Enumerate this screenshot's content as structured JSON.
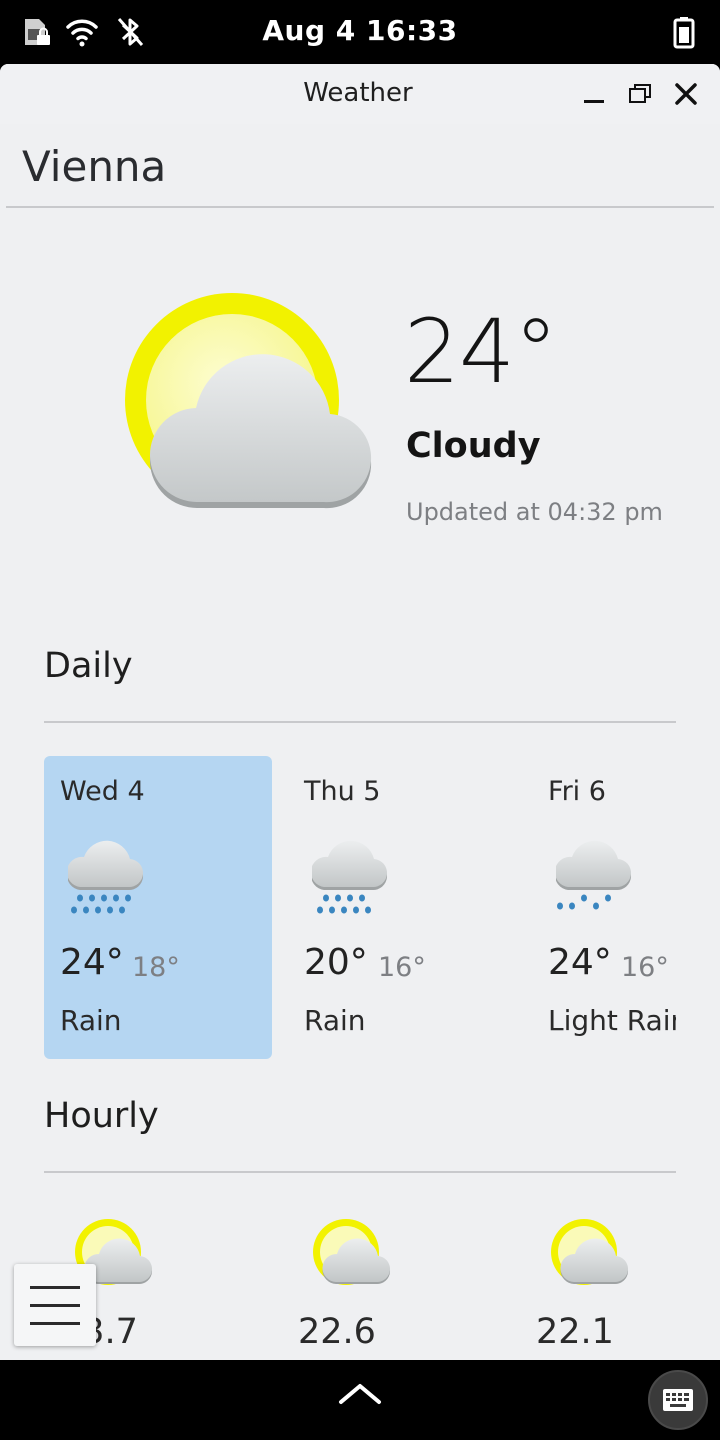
{
  "status_bar": {
    "clock": "Aug 4  16:33",
    "icons": [
      "sim-locked-icon",
      "wifi-icon",
      "bluetooth-off-icon",
      "battery-icon"
    ]
  },
  "window": {
    "title": "Weather",
    "controls": [
      "minimize-icon",
      "maximize-icon",
      "close-icon"
    ]
  },
  "location": {
    "city": "Vienna"
  },
  "current": {
    "temperature": "24°",
    "condition": "Cloudy",
    "updated": "Updated at 04:32 pm",
    "icon": "sun-behind-cloud-icon"
  },
  "daily": {
    "title": "Daily",
    "days": [
      {
        "name": "Wed 4",
        "high": "24°",
        "low": "18°",
        "desc": "Rain",
        "icon": "rain-icon",
        "selected": true
      },
      {
        "name": "Thu 5",
        "high": "20°",
        "low": "16°",
        "desc": "Rain",
        "icon": "rain-icon",
        "selected": false
      },
      {
        "name": "Fri 6",
        "high": "24°",
        "low": "16°",
        "desc": "Light Rain",
        "icon": "light-rain-icon",
        "selected": false
      }
    ]
  },
  "hourly": {
    "title": "Hourly",
    "hours": [
      {
        "temp": "23.7",
        "icon": "sun-behind-cloud-icon"
      },
      {
        "temp": "22.6",
        "icon": "sun-behind-cloud-icon"
      },
      {
        "temp": "22.1",
        "icon": "sun-behind-cloud-icon"
      }
    ]
  },
  "colors": {
    "selected_card": "#b5d6f2",
    "sun": "#f2f200",
    "rain_drop": "#3a86c0",
    "window_bg": "#eff0f2"
  }
}
